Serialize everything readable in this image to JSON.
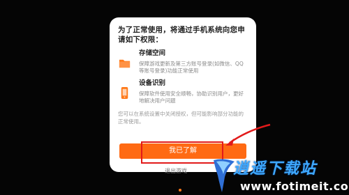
{
  "dialog": {
    "title": "为了正常使用，将通过手机系统向您申请如下权限：",
    "permissions": [
      {
        "name": "存储空间",
        "desc": "保障游戏更新及第三方账号登录(如微信、QQ等账号登录)功能正常使用",
        "icon": "folder-icon",
        "color": "#ff7a1a"
      },
      {
        "name": "设备识别",
        "desc": "保障软件使用安全顺畅，协助识别用户，更好地解决用户问题",
        "icon": "phone-icon",
        "color": "#ff7a1a"
      }
    ],
    "note": "您可以在系统设置中关闭授权，但可能影响部分功能的正常使用。",
    "confirm_label": "我已了解"
  },
  "under_text": "退出游戏",
  "watermark": {
    "title": "逍遥下载站",
    "url": "www.fotimeit.com"
  },
  "colors": {
    "accent": "#ff6a13",
    "highlight": "#e21a1a",
    "background": "#050505"
  }
}
